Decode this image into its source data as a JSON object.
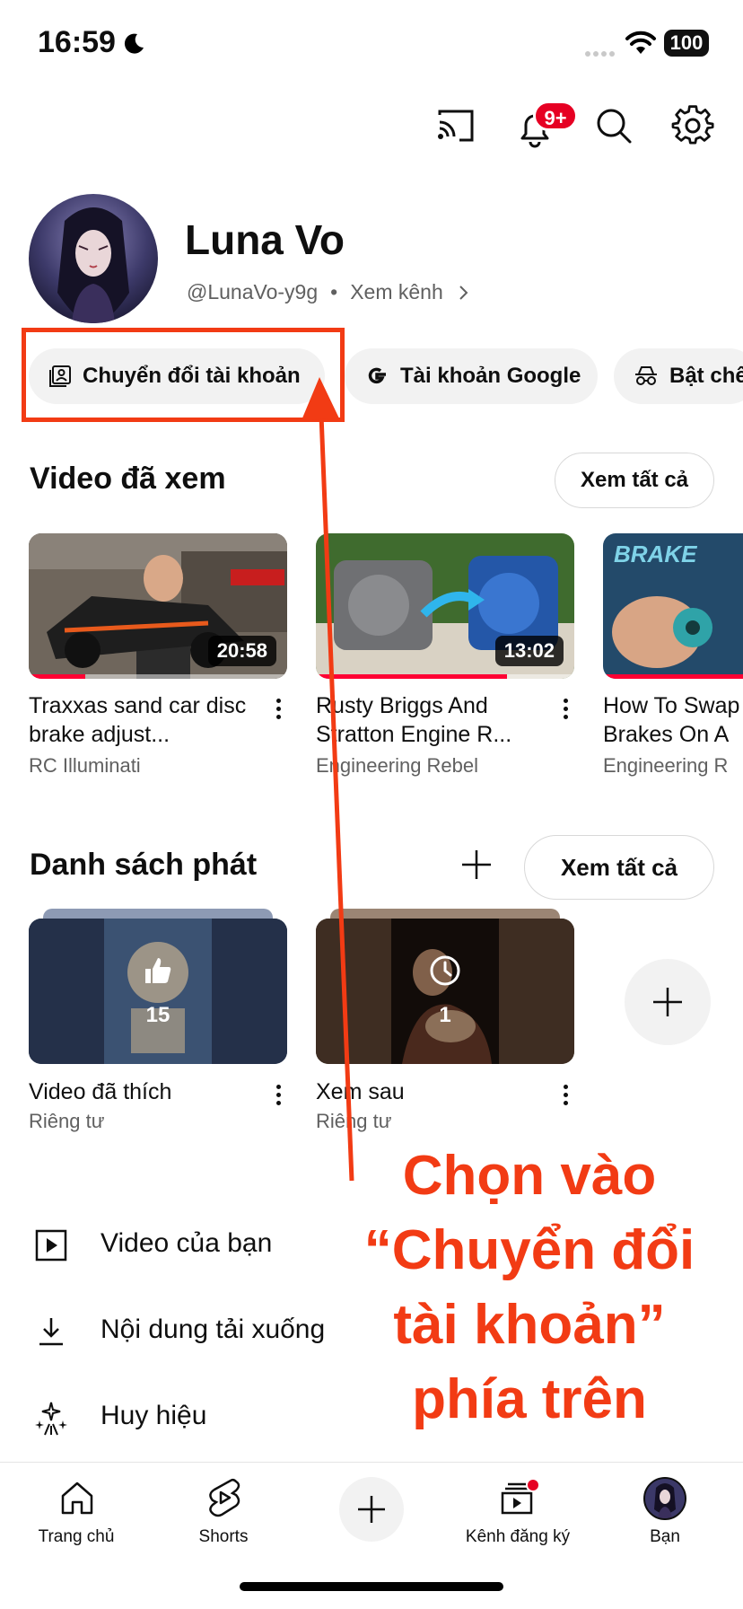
{
  "status_bar": {
    "time": "16:59",
    "battery": "100",
    "icons": [
      "moon-icon",
      "wifi-icon",
      "battery-icon"
    ]
  },
  "header": {
    "notification_badge": "9+",
    "icons": [
      "cast-icon",
      "bell-icon",
      "search-icon",
      "gear-icon"
    ]
  },
  "profile": {
    "name": "Luna Vo",
    "handle": "@LunaVo-y9g",
    "dot": "•",
    "view_channel": "Xem kênh"
  },
  "chips": [
    {
      "label": "Chuyển đổi tài khoản",
      "icon": "switch-account-icon"
    },
    {
      "label": "Tài khoản Google",
      "icon": "google-g-icon"
    },
    {
      "label": "Bật chế",
      "icon": "incognito-icon"
    }
  ],
  "history": {
    "title": "Video đã xem",
    "see_all": "Xem tất cả",
    "videos": [
      {
        "title": "Traxxas sand car disc brake adjust...",
        "channel": "RC Illuminati",
        "duration": "20:58",
        "progress": 0.22
      },
      {
        "title": "Rusty Briggs And Stratton Engine R...",
        "channel": "Engineering Rebel",
        "duration": "13:02",
        "progress": 0.74
      },
      {
        "title": "How To Swap Brakes On A",
        "channel": "Engineering R",
        "duration": "",
        "progress": 1.0
      }
    ]
  },
  "playlists": {
    "title": "Danh sách phát",
    "see_all": "Xem tất cả",
    "items": [
      {
        "title": "Video đã thích",
        "privacy": "Riêng tư",
        "count": "15",
        "icon": "thumbs-up-icon"
      },
      {
        "title": "Xem sau",
        "privacy": "Riêng tư",
        "count": "1",
        "icon": "clock-icon"
      }
    ]
  },
  "menu": [
    {
      "label": "Video của bạn",
      "icon": "play-box-icon"
    },
    {
      "label": "Nội dung tải xuống",
      "icon": "download-icon"
    },
    {
      "label": "Huy hiệu",
      "icon": "sparkles-icon"
    }
  ],
  "bottom_nav": [
    {
      "label": "Trang chủ",
      "icon": "home-icon"
    },
    {
      "label": "Shorts",
      "icon": "shorts-icon"
    },
    {
      "label": "",
      "icon": "create-plus-icon"
    },
    {
      "label": "Kênh đăng ký",
      "icon": "subscriptions-icon"
    },
    {
      "label": "Bạn",
      "icon": "profile-avatar-icon"
    }
  ],
  "annotation": {
    "line1": "Chọn vào",
    "line2": "“Chuyển đổi",
    "line3": "tài khoản”",
    "line4": "phía trên",
    "color": "#f23b14"
  },
  "colors": {
    "accent_red": "#ff0033",
    "badge_red": "#e60023",
    "chip_bg": "#f2f2f2",
    "secondary_text": "#606060"
  }
}
